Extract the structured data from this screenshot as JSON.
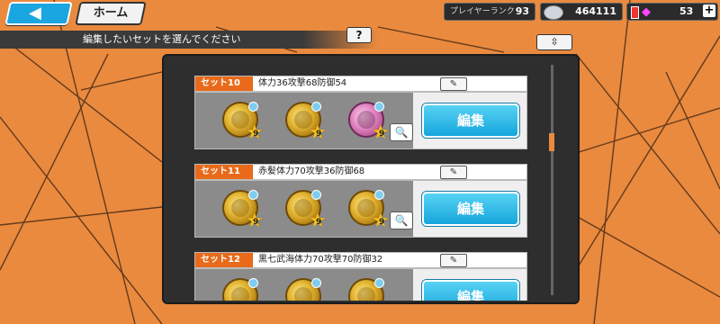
{
  "header": {
    "home_label": "ホーム",
    "player_rank_label": "プレイヤーランク",
    "player_rank_value": "93",
    "coins_value": "464111",
    "gems_value": "53"
  },
  "instruction": "編集したいセットを選んでください",
  "buttons": {
    "help": "?",
    "sort": "⇳",
    "edit": "編集"
  },
  "sets": [
    {
      "tag": "セット10",
      "name": "体力36攻撃68防御54",
      "medals": [
        {
          "level": "9",
          "type": "gold"
        },
        {
          "level": "9",
          "type": "gold"
        },
        {
          "level": "9",
          "type": "pink"
        }
      ]
    },
    {
      "tag": "セット11",
      "name": "赤髪体力70攻撃36防御68",
      "medals": [
        {
          "level": "9",
          "type": "gold"
        },
        {
          "level": "9",
          "type": "gold"
        },
        {
          "level": "9",
          "type": "gold"
        }
      ]
    },
    {
      "tag": "セット12",
      "name": "黒七武海体力70攻撃70防御32",
      "medals": [
        {
          "level": "9",
          "type": "gold"
        },
        {
          "level": "9",
          "type": "gold"
        },
        {
          "level": "9",
          "type": "gold"
        }
      ]
    }
  ],
  "colors": {
    "accent_orange": "#e86a1a",
    "button_blue": "#15a6dc",
    "background_orange": "#e98a3e"
  }
}
